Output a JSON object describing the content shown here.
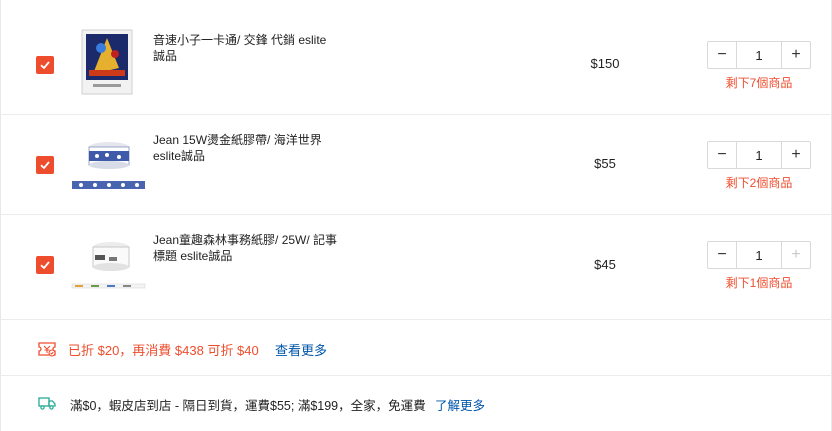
{
  "items": [
    {
      "title": "音速小子一卡通/ 交鋒 代銷 eslite誠品",
      "price": "$150",
      "quantity": "1",
      "stock": "剩下7個商品"
    },
    {
      "title": "Jean 15W燙金紙膠帶/ 海洋世界 eslite誠品",
      "price": "$55",
      "quantity": "1",
      "stock": "剩下2個商品"
    },
    {
      "title": "Jean童趣森林事務紙膠/ 25W/ 記事標題 eslite誠品",
      "price": "$45",
      "quantity": "1",
      "stock": "剩下1個商品"
    }
  ],
  "stepper": {
    "minus": "−",
    "plus": "+"
  },
  "promo": {
    "text": "已折 $20，再消費 $438 可折 $40",
    "link": "查看更多",
    "icon": "voucher-icon"
  },
  "shipping": {
    "text": "滿$0，蝦皮店到店 - 隔日到貨，運費$55; 滿$199，全家，免運費",
    "link": "了解更多",
    "icon": "truck-icon"
  },
  "colors": {
    "accent": "#ee4d2d",
    "link": "#0055aa",
    "border": "#ececec"
  }
}
